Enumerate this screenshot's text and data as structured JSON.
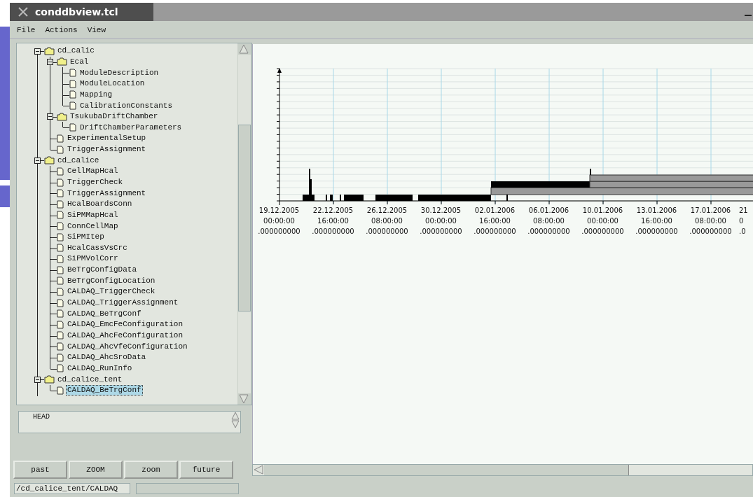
{
  "window": {
    "title": "conddbview.tcl"
  },
  "menu": [
    {
      "label": "File"
    },
    {
      "label": "Actions"
    },
    {
      "label": "View"
    }
  ],
  "tree": [
    {
      "label": "cd_calic",
      "kind": "folder",
      "expanded": true,
      "selected": false,
      "children": [
        {
          "label": "Ecal",
          "kind": "folder",
          "expanded": true,
          "selected": false,
          "children": [
            {
              "label": "ModuleDescription",
              "kind": "file",
              "selected": false
            },
            {
              "label": "ModuleLocation",
              "kind": "file",
              "selected": false
            },
            {
              "label": "Mapping",
              "kind": "file",
              "selected": false
            },
            {
              "label": "CalibrationConstants",
              "kind": "file",
              "selected": false
            }
          ]
        },
        {
          "label": "TsukubaDriftChamber",
          "kind": "folder",
          "expanded": true,
          "selected": false,
          "children": [
            {
              "label": "DriftChamberParameters",
              "kind": "file",
              "selected": false
            }
          ]
        },
        {
          "label": "ExperimentalSetup",
          "kind": "file",
          "selected": false
        },
        {
          "label": "TriggerAssignment",
          "kind": "file",
          "selected": false
        }
      ]
    },
    {
      "label": "cd_calice",
      "kind": "folder",
      "expanded": true,
      "selected": false,
      "children": [
        {
          "label": "CellMapHcal",
          "kind": "file",
          "selected": false
        },
        {
          "label": "TriggerCheck",
          "kind": "file",
          "selected": false
        },
        {
          "label": "TriggerAssignment",
          "kind": "file",
          "selected": false
        },
        {
          "label": "HcalBoardsConn",
          "kind": "file",
          "selected": false
        },
        {
          "label": "SiPMMapHcal",
          "kind": "file",
          "selected": false
        },
        {
          "label": "ConnCellMap",
          "kind": "file",
          "selected": false
        },
        {
          "label": "SiPMItep",
          "kind": "file",
          "selected": false
        },
        {
          "label": "HcalCassVsCrc",
          "kind": "file",
          "selected": false
        },
        {
          "label": "SiPMVolCorr",
          "kind": "file",
          "selected": false
        },
        {
          "label": "BeTrgConfigData",
          "kind": "file",
          "selected": false
        },
        {
          "label": "BeTrgConfigLocation",
          "kind": "file",
          "selected": false
        },
        {
          "label": "CALDAQ_TriggerCheck",
          "kind": "file",
          "selected": false
        },
        {
          "label": "CALDAQ_TriggerAssignment",
          "kind": "file",
          "selected": false
        },
        {
          "label": "CALDAQ_BeTrgConf",
          "kind": "file",
          "selected": false
        },
        {
          "label": "CALDAQ_EmcFeConfiguration",
          "kind": "file",
          "selected": false
        },
        {
          "label": "CALDAQ_AhcFeConfiguration",
          "kind": "file",
          "selected": false
        },
        {
          "label": "CALDAQ_AhcVfeConfiguration",
          "kind": "file",
          "selected": false
        },
        {
          "label": "CALDAQ_AhcSroData",
          "kind": "file",
          "selected": false
        },
        {
          "label": "CALDAQ_RunInfo",
          "kind": "file",
          "selected": false
        }
      ]
    },
    {
      "label": "cd_calice_tent",
      "kind": "folder",
      "expanded": true,
      "selected": false,
      "children": [
        {
          "label": "CALDAQ_BeTrgConf",
          "kind": "file",
          "selected": true
        }
      ]
    }
  ],
  "versions": [
    {
      "label": "HEAD"
    }
  ],
  "timeline": {
    "ticks": [
      {
        "date": "19.12.2005",
        "time": "00:00:00",
        "fraction": ".000000000"
      },
      {
        "date": "22.12.2005",
        "time": "16:00:00",
        "fraction": ".000000000"
      },
      {
        "date": "26.12.2005",
        "time": "08:00:00",
        "fraction": ".000000000"
      },
      {
        "date": "30.12.2005",
        "time": "00:00:00",
        "fraction": ".000000000"
      },
      {
        "date": "02.01.2006",
        "time": "16:00:00",
        "fraction": ".000000000"
      },
      {
        "date": "06.01.2006",
        "time": "08:00:00",
        "fraction": ".000000000"
      },
      {
        "date": "10.01.2006",
        "time": "00:00:00",
        "fraction": ".000000000"
      },
      {
        "date": "13.01.2006",
        "time": "16:00:00",
        "fraction": ".000000000"
      },
      {
        "date": "17.01.2006",
        "time": "08:00:00",
        "fraction": ".000000000"
      },
      {
        "date": "21",
        "time": "0",
        "fraction": ".0"
      }
    ]
  },
  "buttons": [
    {
      "label": "past"
    },
    {
      "label": "ZOOM"
    },
    {
      "label": "zoom"
    },
    {
      "label": "future"
    }
  ],
  "status_bar": {
    "path": "/cd_calice_tent/CALDAQ"
  }
}
